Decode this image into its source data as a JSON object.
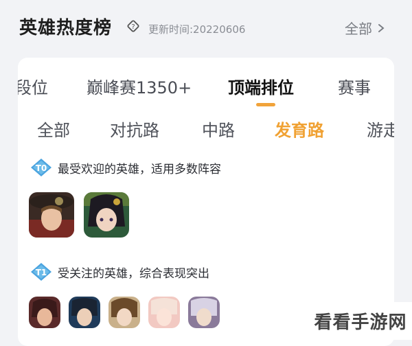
{
  "header": {
    "title": "英雄热度榜",
    "updated": "更新时间:20220606",
    "all_label": "全部"
  },
  "tabs": [
    {
      "label": "段位"
    },
    {
      "label": "巅峰赛1350+"
    },
    {
      "label": "顶端排位",
      "active": true
    },
    {
      "label": "赛事"
    }
  ],
  "subtabs": [
    {
      "label": "全部"
    },
    {
      "label": "对抗路"
    },
    {
      "label": "中路"
    },
    {
      "label": "发育路",
      "active": true
    },
    {
      "label": "游走"
    }
  ],
  "tiers": [
    {
      "badge": "T0",
      "text": "最受欢迎的英雄，适用多数阵容",
      "hero_count": 2
    },
    {
      "badge": "T1",
      "text": "受关注的英雄，综合表现突出",
      "hero_count": 5
    }
  ],
  "watermark": "看看手游网",
  "colors": {
    "accent": "#f0a132",
    "badge": "#4aa3df",
    "background": "#f2f3f6"
  }
}
